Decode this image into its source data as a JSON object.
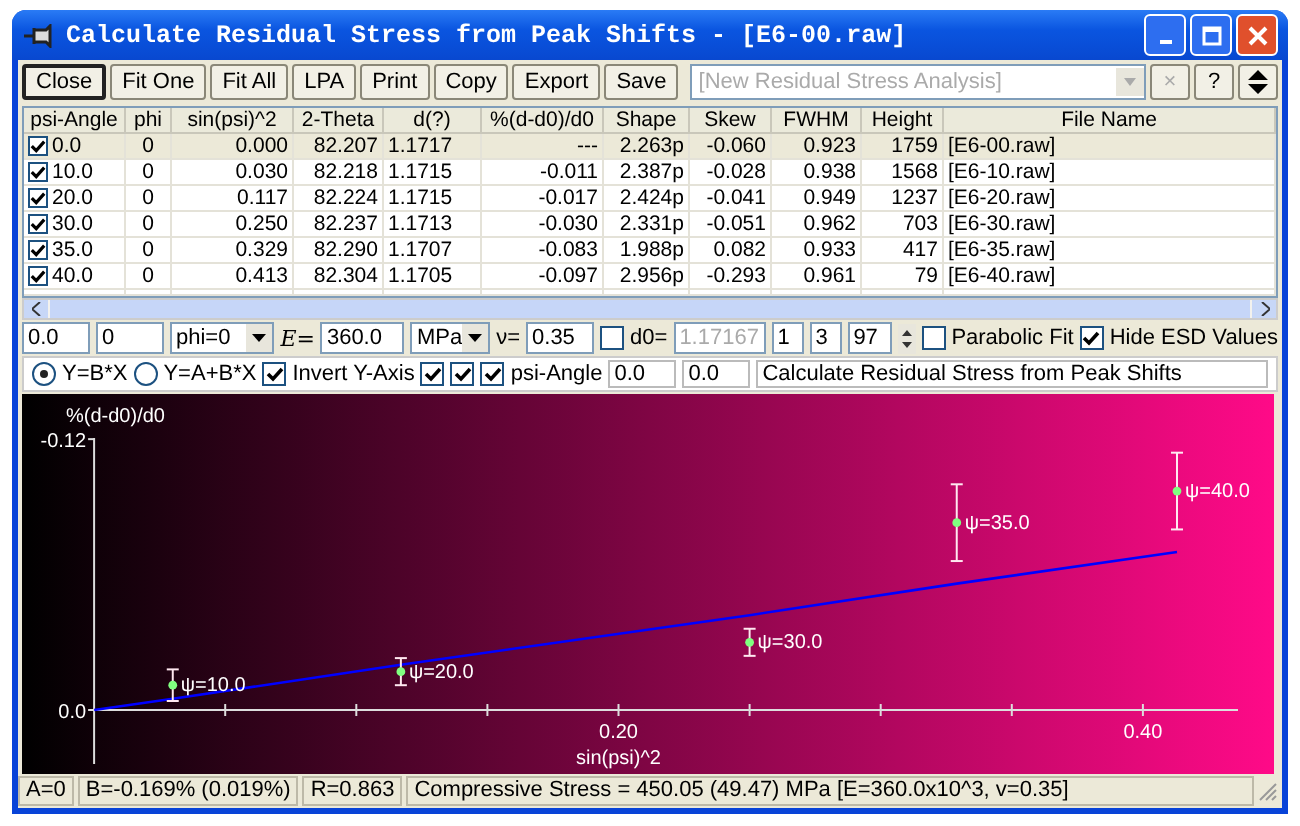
{
  "window": {
    "title": "Calculate Residual Stress from Peak Shifts - [E6-00.raw]"
  },
  "toolbar": {
    "buttons": [
      "Close",
      "Fit One",
      "Fit All",
      "LPA",
      "Print",
      "Copy",
      "Export",
      "Save"
    ],
    "analysis_combo": {
      "value": "[New Residual Stress Analysis]",
      "disabled": true
    },
    "delete_button": {
      "label": "×",
      "disabled": true
    },
    "help_button": {
      "label": "?"
    }
  },
  "table": {
    "columns": [
      "psi-Angle",
      "phi",
      "sin(psi)^2",
      "2-Theta",
      "d(?)",
      "%(d-d0)/d0",
      "Shape",
      "Skew",
      "FWHM",
      "Height",
      "File Name"
    ],
    "rows": [
      {
        "checked": true,
        "selected": true,
        "cells": [
          "0.0",
          "0",
          "0.000",
          "82.207",
          "1.1717",
          "---",
          "2.263p",
          "-0.060",
          "0.923",
          "1759",
          "[E6-00.raw]"
        ]
      },
      {
        "checked": true,
        "selected": false,
        "cells": [
          "10.0",
          "0",
          "0.030",
          "82.218",
          "1.1715",
          "-0.011",
          "2.387p",
          "-0.028",
          "0.938",
          "1568",
          "[E6-10.raw]"
        ]
      },
      {
        "checked": true,
        "selected": false,
        "cells": [
          "20.0",
          "0",
          "0.117",
          "82.224",
          "1.1715",
          "-0.017",
          "2.424p",
          "-0.041",
          "0.949",
          "1237",
          "[E6-20.raw]"
        ]
      },
      {
        "checked": true,
        "selected": false,
        "cells": [
          "30.0",
          "0",
          "0.250",
          "82.237",
          "1.1713",
          "-0.030",
          "2.331p",
          "-0.051",
          "0.962",
          "703",
          "[E6-30.raw]"
        ]
      },
      {
        "checked": true,
        "selected": false,
        "cells": [
          "35.0",
          "0",
          "0.329",
          "82.290",
          "1.1707",
          "-0.083",
          "1.988p",
          "0.082",
          "0.933",
          "417",
          "[E6-35.raw]"
        ]
      },
      {
        "checked": true,
        "selected": false,
        "cells": [
          "40.0",
          "0",
          "0.413",
          "82.304",
          "1.1705",
          "-0.097",
          "2.956p",
          "-0.293",
          "0.961",
          "79",
          "[E6-40.raw]"
        ]
      }
    ]
  },
  "params": {
    "field_1": "0.0",
    "field_2": "0",
    "phi_select": "phi=0",
    "e_label": "E=",
    "e_value": "360.0",
    "unit_select": "MPa",
    "nu_label": "ν=",
    "nu_value": "0.35",
    "d0_checked": false,
    "d0_label": "d0=",
    "d0_value": "1.17167",
    "d0_disabled": true,
    "field_3": "1",
    "field_4": "3",
    "field_5": "97",
    "options": [
      {
        "label": "Parabolic Fit",
        "checked": false
      },
      {
        "label": "Hide ESD Values",
        "checked": true
      }
    ]
  },
  "plot_options": {
    "radios": [
      {
        "label": "Y=B*X",
        "selected": true
      },
      {
        "label": "Y=A+B*X",
        "selected": false
      }
    ],
    "checks": [
      {
        "label": "Invert Y-Axis",
        "checked": true
      },
      {
        "checked": true
      },
      {
        "checked": true
      },
      {
        "label": "psi-Angle",
        "checked": true
      }
    ],
    "field_1": "0.0",
    "field_2": "0.0",
    "title_field": "Calculate Residual Stress from Peak Shifts"
  },
  "chart": {
    "chart_data": {
      "type": "scatter",
      "xlabel": "sin(psi)^2",
      "ylabel": "%(d-d0)/d0",
      "x": [
        0.0,
        0.03,
        0.117,
        0.25,
        0.329,
        0.413
      ],
      "series": [
        {
          "color": "#80ff80",
          "values": [
            null,
            -0.011,
            -0.017,
            -0.03,
            -0.083,
            -0.097
          ],
          "errors": [
            null,
            0.007,
            0.006,
            0.006,
            0.017,
            0.017
          ]
        },
        {
          "type": "line",
          "color": "#0000ff",
          "values": [
            0,
            -0.005,
            -0.02,
            -0.042,
            -0.056,
            -0.07
          ]
        }
      ],
      "xlim": [
        -0.0275,
        0.45
      ],
      "ylim": [
        0.031,
        -0.14
      ],
      "xticks": [
        {
          "value": 0.2,
          "label": "0.20"
        },
        {
          "value": 0.4,
          "label": "0.40"
        }
      ],
      "yticks": [
        {
          "value": -0.12,
          "label": "-0.12"
        },
        {
          "value": 0,
          "label": "0.0"
        }
      ],
      "annotations": [
        {
          "x": 0.03,
          "y": -0.011,
          "text": "ψ=10.0"
        },
        {
          "x": 0.117,
          "y": -0.017,
          "text": "ψ=20.0"
        },
        {
          "x": 0.25,
          "y": -0.03,
          "text": "ψ=30.0"
        },
        {
          "x": 0.329,
          "y": -0.083,
          "text": "ψ=35.0"
        },
        {
          "x": 0.413,
          "y": -0.097,
          "text": "ψ=40.0"
        }
      ]
    }
  },
  "status_bar": [
    "A=0",
    "B=-0.169% (0.019%)",
    "R=0.863",
    "Compressive Stress = 450.05 (49.47) MPa [E=360.0x10^3, v=0.35]"
  ]
}
